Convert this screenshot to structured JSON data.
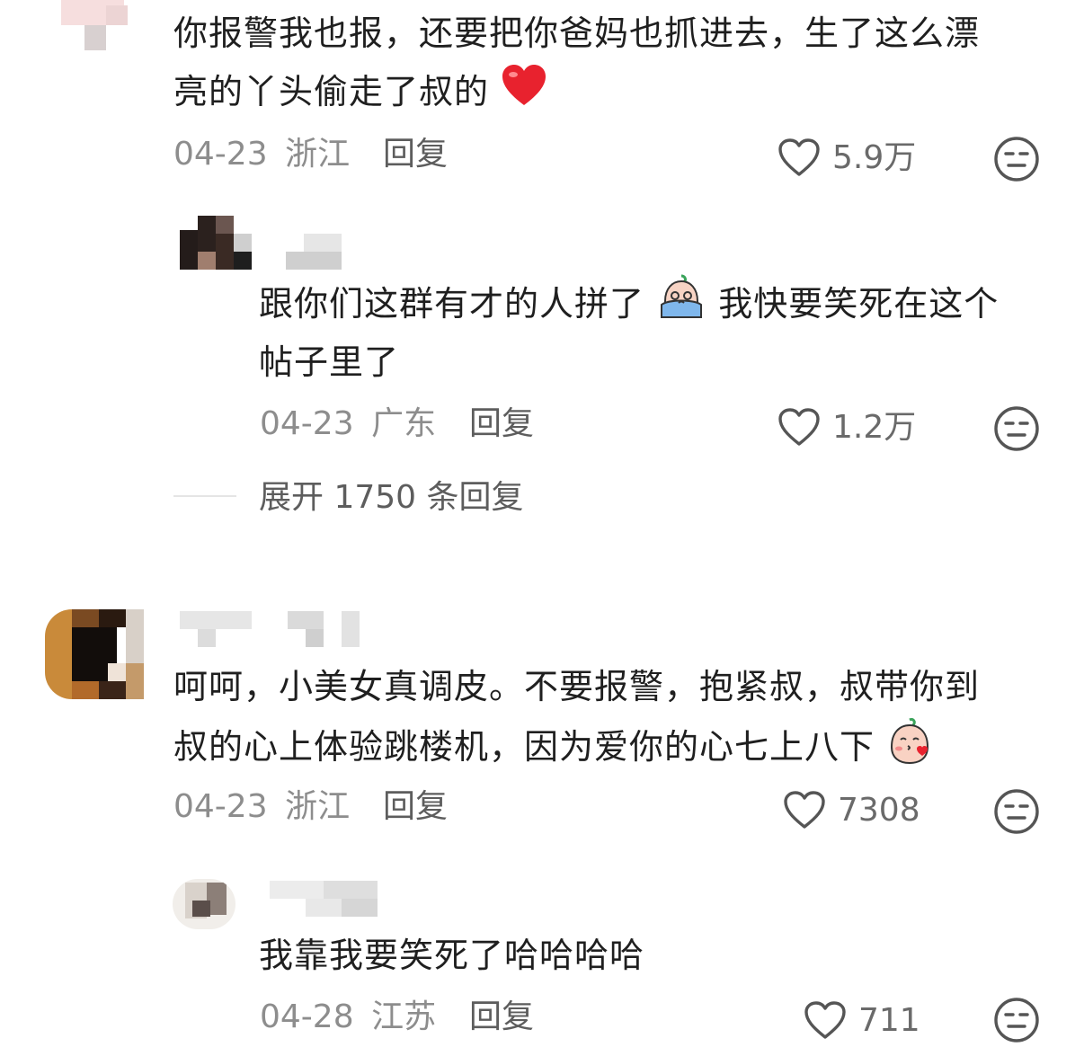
{
  "comments": [
    {
      "text_line1": "你报警我也报，还要把你爸妈也抓进去，生了这么漂",
      "text_line2": "亮的丫头偷走了叔的",
      "emoji": "heart-emoji",
      "date": "04-23",
      "location": "浙江",
      "reply_label": "回复",
      "likes": "5.9万",
      "dislike_icon": "meh-face-icon"
    },
    {
      "text_line1_a": "跟你们这群有才的人拼了",
      "text_line1_b": "我快要笑死在这个",
      "text_line2": "帖子里了",
      "emoji": "crying-face-emoji",
      "date": "04-23",
      "location": "广东",
      "reply_label": "回复",
      "likes": "1.2万",
      "dislike_icon": "meh-face-icon"
    },
    {
      "expand_label": "展开 1750 条回复"
    },
    {
      "text_line1": "呵呵，小美女真调皮。不要报警，抱紧叔，叔带你到",
      "text_line2": "叔的心上体验跳楼机，因为爱你的心七上八下",
      "emoji": "kiss-face-emoji",
      "date": "04-23",
      "location": "浙江",
      "reply_label": "回复",
      "likes": "7308",
      "dislike_icon": "meh-face-icon"
    },
    {
      "text_line1": "我靠我要笑死了哈哈哈哈",
      "date": "04-28",
      "location": "江苏",
      "reply_label": "回复",
      "likes": "711",
      "dislike_icon": "meh-face-icon"
    }
  ],
  "colors": {
    "text": "#1f1f1f",
    "meta": "#8d8d8d",
    "reply": "#5d5d5d",
    "heart_emoji": "#e8222e"
  }
}
